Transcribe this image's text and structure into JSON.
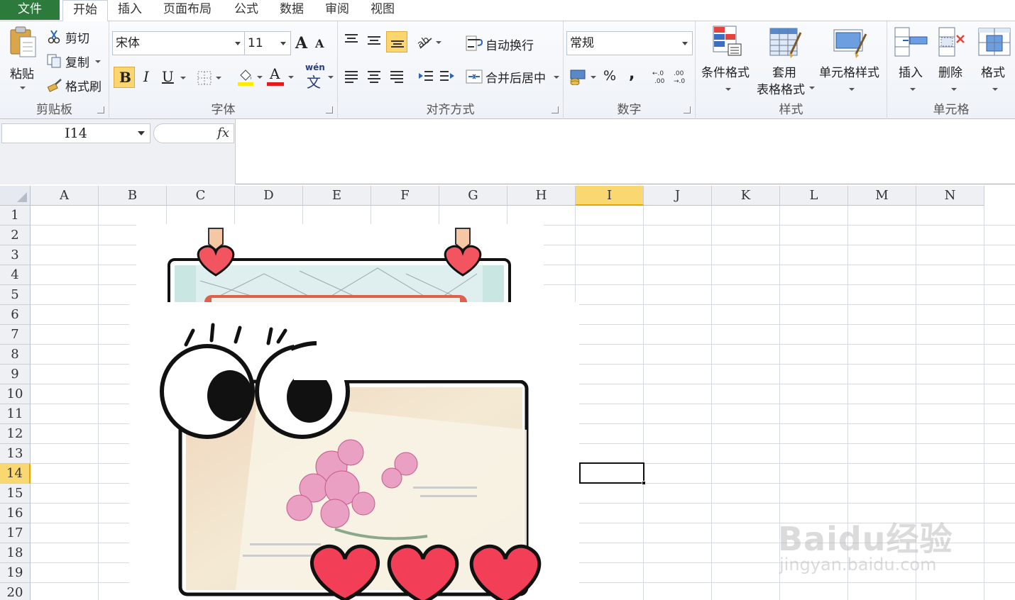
{
  "tabs": {
    "file": "文件",
    "home": "开始",
    "insert": "插入",
    "page_layout": "页面布局",
    "formulas": "公式",
    "data": "数据",
    "review": "审阅",
    "view": "视图"
  },
  "clipboard": {
    "paste": "粘贴",
    "cut": "剪切",
    "copy": "复制",
    "format_painter": "格式刷",
    "group_label": "剪贴板"
  },
  "font": {
    "name": "宋体",
    "size": "11",
    "bold": "B",
    "italic": "I",
    "underline": "U",
    "font_color_glyph": "A",
    "phonetic_glyph": "wén",
    "phonetic_char": "文",
    "grow_glyph": "A",
    "shrink_glyph": "A",
    "group_label": "字体"
  },
  "alignment": {
    "wrap_text": "自动换行",
    "merge_center": "合并后居中",
    "group_label": "对齐方式"
  },
  "number": {
    "format": "常规",
    "percent": "%",
    "comma": ",",
    "inc_decimal": "←.0 .00",
    "dec_decimal": ".00 →.0",
    "group_label": "数字"
  },
  "styles": {
    "conditional_formatting": "条件格式",
    "format_as_table_line1": "套用",
    "format_as_table_line2": "表格格式",
    "cell_styles": "单元格样式",
    "group_label": "样式"
  },
  "cells": {
    "insert": "插入",
    "delete": "删除",
    "format": "格式",
    "group_label": "单元格"
  },
  "formula_bar": {
    "name_box": "I14",
    "fx": "fx",
    "formula": ""
  },
  "columns": [
    "A",
    "B",
    "C",
    "D",
    "E",
    "F",
    "G",
    "H",
    "I",
    "J",
    "K",
    "L",
    "M",
    "N"
  ],
  "rows": [
    "1",
    "2",
    "3",
    "4",
    "5",
    "6",
    "7",
    "8",
    "9",
    "10",
    "11",
    "12",
    "13",
    "14",
    "15",
    "16",
    "17",
    "18",
    "19",
    "20"
  ],
  "selected_cell": {
    "column": "I",
    "row": "14"
  },
  "watermark": {
    "logo": "Baidu经验",
    "url": "jingyan.baidu.com"
  },
  "colors": {
    "file_tab": "#2c7a3c",
    "selection_header": "#fad871",
    "heart": "#f25560"
  }
}
